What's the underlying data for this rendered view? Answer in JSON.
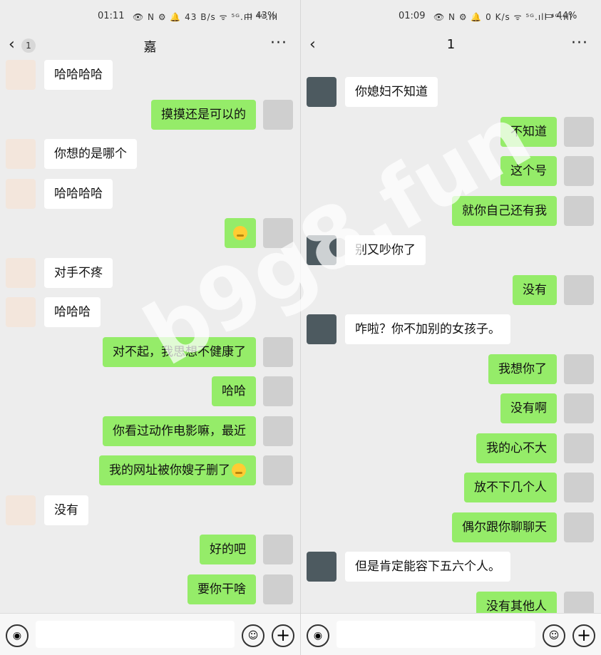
{
  "left": {
    "status": {
      "time": "01:11",
      "icons": "👁 N ⚙ 🔔 43 B/s ᯤ ⁵ᴳ.ıll ⁴ᴳ.ıll",
      "battery": "▭ 43%"
    },
    "title": "嘉",
    "badge": "1",
    "messages": [
      {
        "side": "in",
        "text": "哈哈哈哈"
      },
      {
        "side": "out",
        "text": "摸摸还是可以的"
      },
      {
        "side": "in",
        "text": "你想的是哪个"
      },
      {
        "side": "in",
        "text": "哈哈哈哈"
      },
      {
        "side": "out",
        "text": "",
        "emoji": true
      },
      {
        "side": "in",
        "text": "对手不疼"
      },
      {
        "side": "in",
        "text": "哈哈哈"
      },
      {
        "side": "out",
        "text": "对不起，我思想不健康了"
      },
      {
        "side": "out",
        "text": "哈哈"
      },
      {
        "side": "out",
        "text": "你看过动作电影嘛，最近"
      },
      {
        "side": "out",
        "text": "我的网址被你嫂子删了",
        "emoji": true
      },
      {
        "side": "in",
        "text": "没有"
      },
      {
        "side": "out",
        "text": "好的吧"
      },
      {
        "side": "out",
        "text": "要你干啥"
      }
    ]
  },
  "right": {
    "status": {
      "time": "01:09",
      "icons": "👁 N ⚙ 🔔 0 K/s ᯤ ⁵ᴳ.ıll ⁴ᴳ.ıll",
      "battery": "▭ 44%"
    },
    "title": "1",
    "messages": [
      {
        "side": "in",
        "text": "你媳妇不知道"
      },
      {
        "side": "out",
        "text": "不知道"
      },
      {
        "side": "out",
        "text": "这个号"
      },
      {
        "side": "out",
        "text": "就你自己还有我"
      },
      {
        "side": "in",
        "text": "别又吵你了"
      },
      {
        "side": "out",
        "text": "没有"
      },
      {
        "side": "in",
        "text": "咋啦？你不加别的女孩子。"
      },
      {
        "side": "out",
        "text": "我想你了"
      },
      {
        "side": "out",
        "text": "没有啊"
      },
      {
        "side": "out",
        "text": "我的心不大"
      },
      {
        "side": "out",
        "text": "放不下几个人"
      },
      {
        "side": "out",
        "text": "偶尔跟你聊聊天"
      },
      {
        "side": "in",
        "text": "但是肯定能容下五六个人。"
      },
      {
        "side": "out",
        "text": "没有其他人"
      }
    ]
  },
  "icons": {
    "back": "chevron-left-icon",
    "more": "more-icon",
    "voice": "voice-icon",
    "emoji": "emoji-icon",
    "plus": "plus-icon"
  },
  "colors": {
    "bubble_out": "#95ec69",
    "bubble_in": "#ffffff",
    "background": "#ededed"
  },
  "watermark": "b9g8.fun"
}
